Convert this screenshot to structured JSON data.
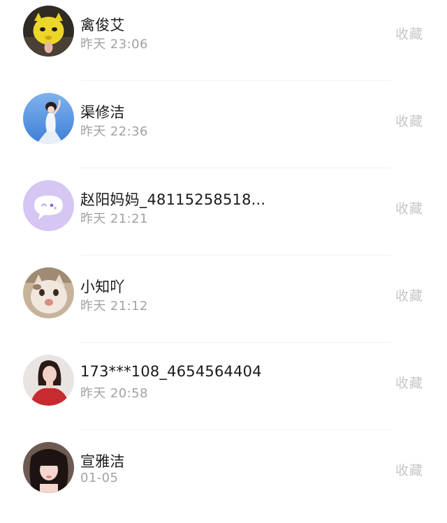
{
  "contacts": [
    {
      "name": "禽俊艾",
      "time": "昨天 23:06",
      "action": "收藏",
      "avatar": "yellow-mask-avatar"
    },
    {
      "name": "渠修洁",
      "time": "昨天 22:36",
      "action": "收藏",
      "avatar": "dancer-blue-sky-avatar"
    },
    {
      "name": "赵阳妈妈_48115258518...",
      "time": "昨天 21:21",
      "action": "收藏",
      "avatar": "purple-chat-bubble-avatar"
    },
    {
      "name": "小知吖",
      "time": "昨天 21:12",
      "action": "收藏",
      "avatar": "cat-avatar"
    },
    {
      "name": "173***108_4654564404",
      "time": "昨天 20:58",
      "action": "收藏",
      "avatar": "girl-red-dress-avatar"
    },
    {
      "name": "宣雅洁",
      "time": "01-05",
      "action": "收藏",
      "avatar": "girl-dark-hair-avatar"
    }
  ]
}
